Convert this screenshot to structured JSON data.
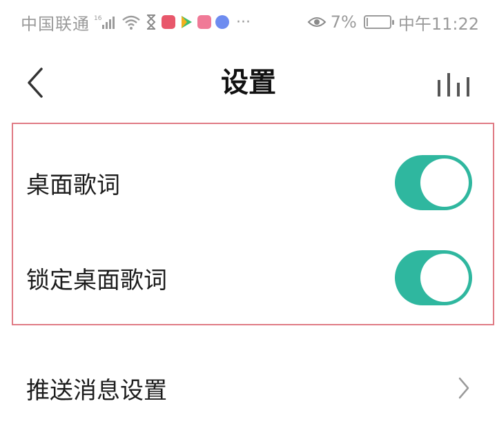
{
  "status_bar": {
    "carrier": "中国联通",
    "network_badge": "16",
    "battery_percent": "7%",
    "battery_level": 0.07,
    "time": "中午11:22",
    "ellipsis": "···",
    "icons": [
      "signal-icon",
      "wifi-icon",
      "hourglass-icon",
      "app-icon-red",
      "app-icon-play",
      "app-icon-pink",
      "app-icon-blue",
      "eye-icon",
      "battery-icon"
    ]
  },
  "header": {
    "title": "设置",
    "back_icon": "chevron-left-icon",
    "action_icon": "equalizer-icon"
  },
  "settings": {
    "desktop_lyrics": {
      "label": "桌面歌词",
      "enabled": true
    },
    "lock_desktop_lyrics": {
      "label": "锁定桌面歌词",
      "enabled": true
    },
    "push_settings": {
      "label": "推送消息设置",
      "icon": "chevron-right-icon"
    }
  },
  "colors": {
    "toggle_on": "#2fb79f",
    "highlight_border": "#e07a84",
    "status_text": "#9a9a9a"
  }
}
